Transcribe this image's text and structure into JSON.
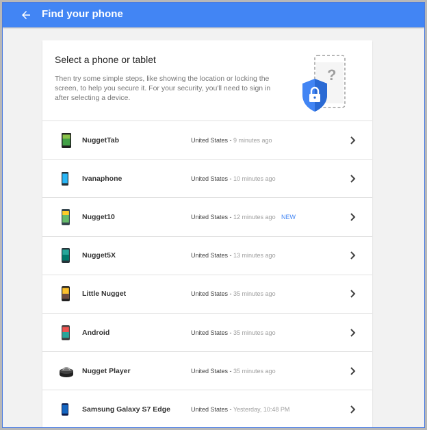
{
  "header": {
    "title": "Find your phone",
    "bar_color": "#4285f4",
    "back_icon": "arrow-back-icon"
  },
  "card": {
    "title": "Select a phone or tablet",
    "description": "Then try some simple steps, like showing the location or locking the screen, to help you secure it. For your security, you'll need to sign in after selecting a device.",
    "illustration": "phone-lock-shield-icon"
  },
  "devices": [
    {
      "name": "NuggetTab",
      "location": "United States",
      "time": "9 minutes ago",
      "badge": "",
      "icon": "tablet-icon"
    },
    {
      "name": "Ivanaphone",
      "location": "United States",
      "time": "10 minutes ago",
      "badge": "",
      "icon": "phone-icon"
    },
    {
      "name": "Nugget10",
      "location": "United States",
      "time": "12 minutes ago",
      "badge": "NEW",
      "icon": "phone-icon"
    },
    {
      "name": "Nugget5X",
      "location": "United States",
      "time": "13 minutes ago",
      "badge": "",
      "icon": "phone-icon"
    },
    {
      "name": "Little Nugget",
      "location": "United States",
      "time": "35 minutes ago",
      "badge": "",
      "icon": "phone-icon"
    },
    {
      "name": "Android",
      "location": "United States",
      "time": "35 minutes ago",
      "badge": "",
      "icon": "phone-icon"
    },
    {
      "name": "Nugget Player",
      "location": "United States",
      "time": "35 minutes ago",
      "badge": "",
      "icon": "media-player-icon"
    },
    {
      "name": "Samsung Galaxy S7 Edge",
      "location": "United States",
      "time": "Yesterday, 10:48 PM",
      "badge": "",
      "icon": "phone-icon"
    }
  ]
}
